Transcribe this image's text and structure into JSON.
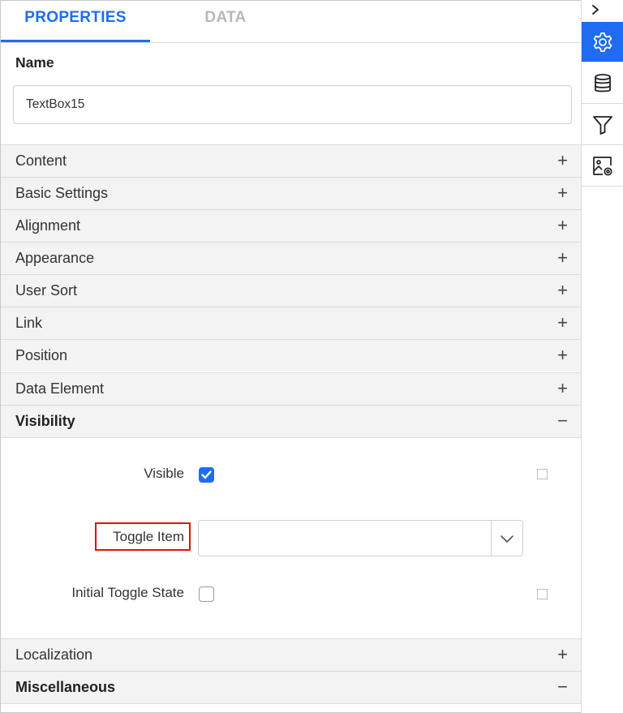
{
  "tabs": {
    "properties": "PROPERTIES",
    "data": "DATA"
  },
  "name": {
    "label": "Name",
    "value": "TextBox15"
  },
  "sections": {
    "content": "Content",
    "basic_settings": "Basic Settings",
    "alignment": "Alignment",
    "appearance": "Appearance",
    "user_sort": "User Sort",
    "link": "Link",
    "position": "Position",
    "data_element": "Data Element",
    "visibility": "Visibility",
    "localization": "Localization",
    "miscellaneous": "Miscellaneous"
  },
  "signs": {
    "collapsed": "+",
    "expanded": "−"
  },
  "visibility": {
    "visible_label": "Visible",
    "visible_checked": true,
    "toggle_item_label": "Toggle Item",
    "toggle_item_value": "",
    "initial_toggle_state_label": "Initial Toggle State",
    "initial_toggle_state_checked": false
  },
  "rail": {
    "icons": [
      "chevron-right-icon",
      "settings-gear-icon",
      "database-icon",
      "filter-icon",
      "image-settings-icon"
    ]
  },
  "colors": {
    "accent": "#1f6cf0",
    "highlight": "#e01010",
    "header_bg": "#f3f3f3"
  }
}
